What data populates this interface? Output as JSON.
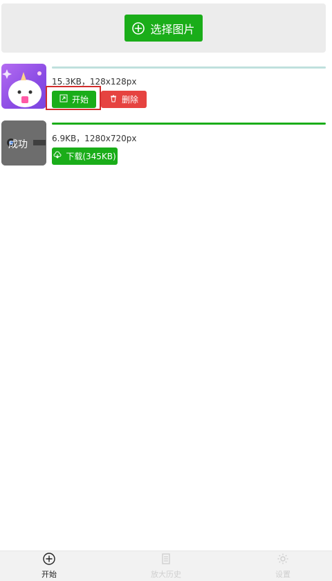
{
  "top": {
    "select_label": "选择图片"
  },
  "items": [
    {
      "meta": "15.3KB，128x128px",
      "progress": 1,
      "start_label": "开始",
      "delete_label": "删除"
    },
    {
      "meta": "6.9KB，1280x720px",
      "progress": 1,
      "thumb_text": "成功",
      "download_label": "下载(345KB)"
    }
  ],
  "tabbar": {
    "items": [
      {
        "label": "开始",
        "icon": "plus-circle-icon",
        "active": true
      },
      {
        "label": "放大历史",
        "icon": "document-icon",
        "active": false
      },
      {
        "label": "设置",
        "icon": "gear-icon",
        "active": false
      }
    ]
  },
  "colors": {
    "primary": "#1aad19",
    "danger": "#e64340",
    "highlight": "#d22c2c"
  }
}
